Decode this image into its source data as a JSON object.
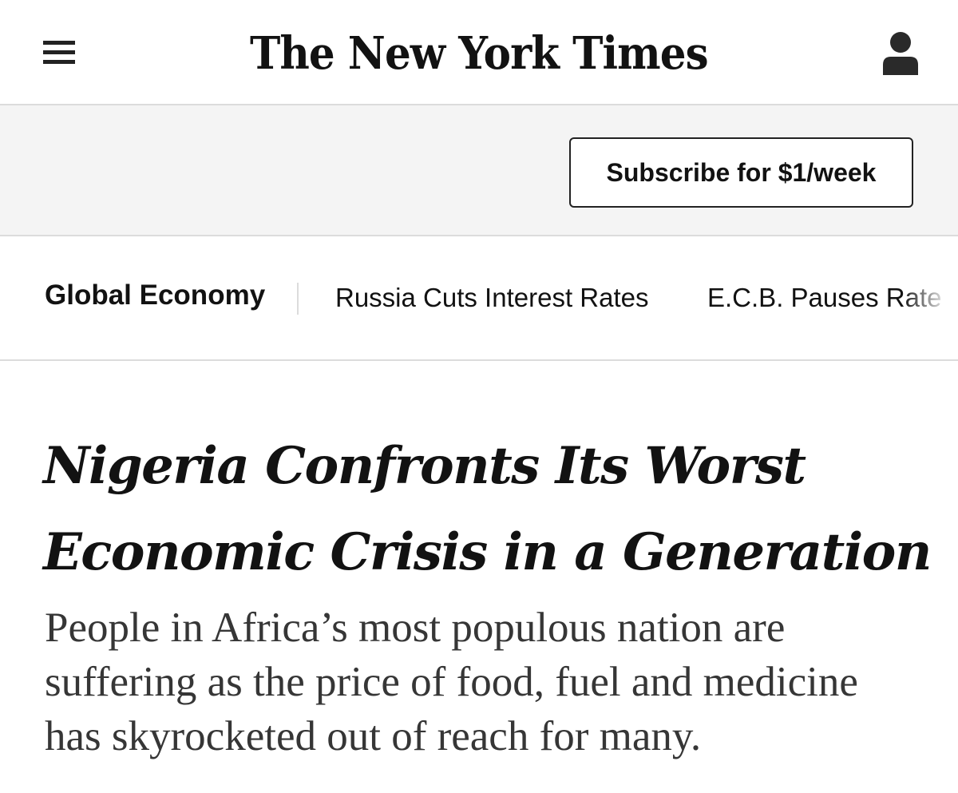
{
  "masthead": {
    "logo_text": "The New York Times",
    "menu_icon": "hamburger-menu-icon",
    "account_icon": "person-icon"
  },
  "subscribe": {
    "label": "Subscribe for $1/week"
  },
  "section_nav": {
    "title": "Global Economy",
    "links": [
      {
        "label": "Russia Cuts Interest Rates"
      },
      {
        "label": "E.C.B. Pauses Rate"
      }
    ]
  },
  "article": {
    "headline_lines": [
      "Nigeria Confronts Its Worst",
      "Economic Crisis in a Generation"
    ],
    "summary_lines": [
      "People in Africa’s most populous nation are",
      "suffering as the price of food, fuel and medicine",
      "has skyrocketed out of reach for many."
    ]
  }
}
